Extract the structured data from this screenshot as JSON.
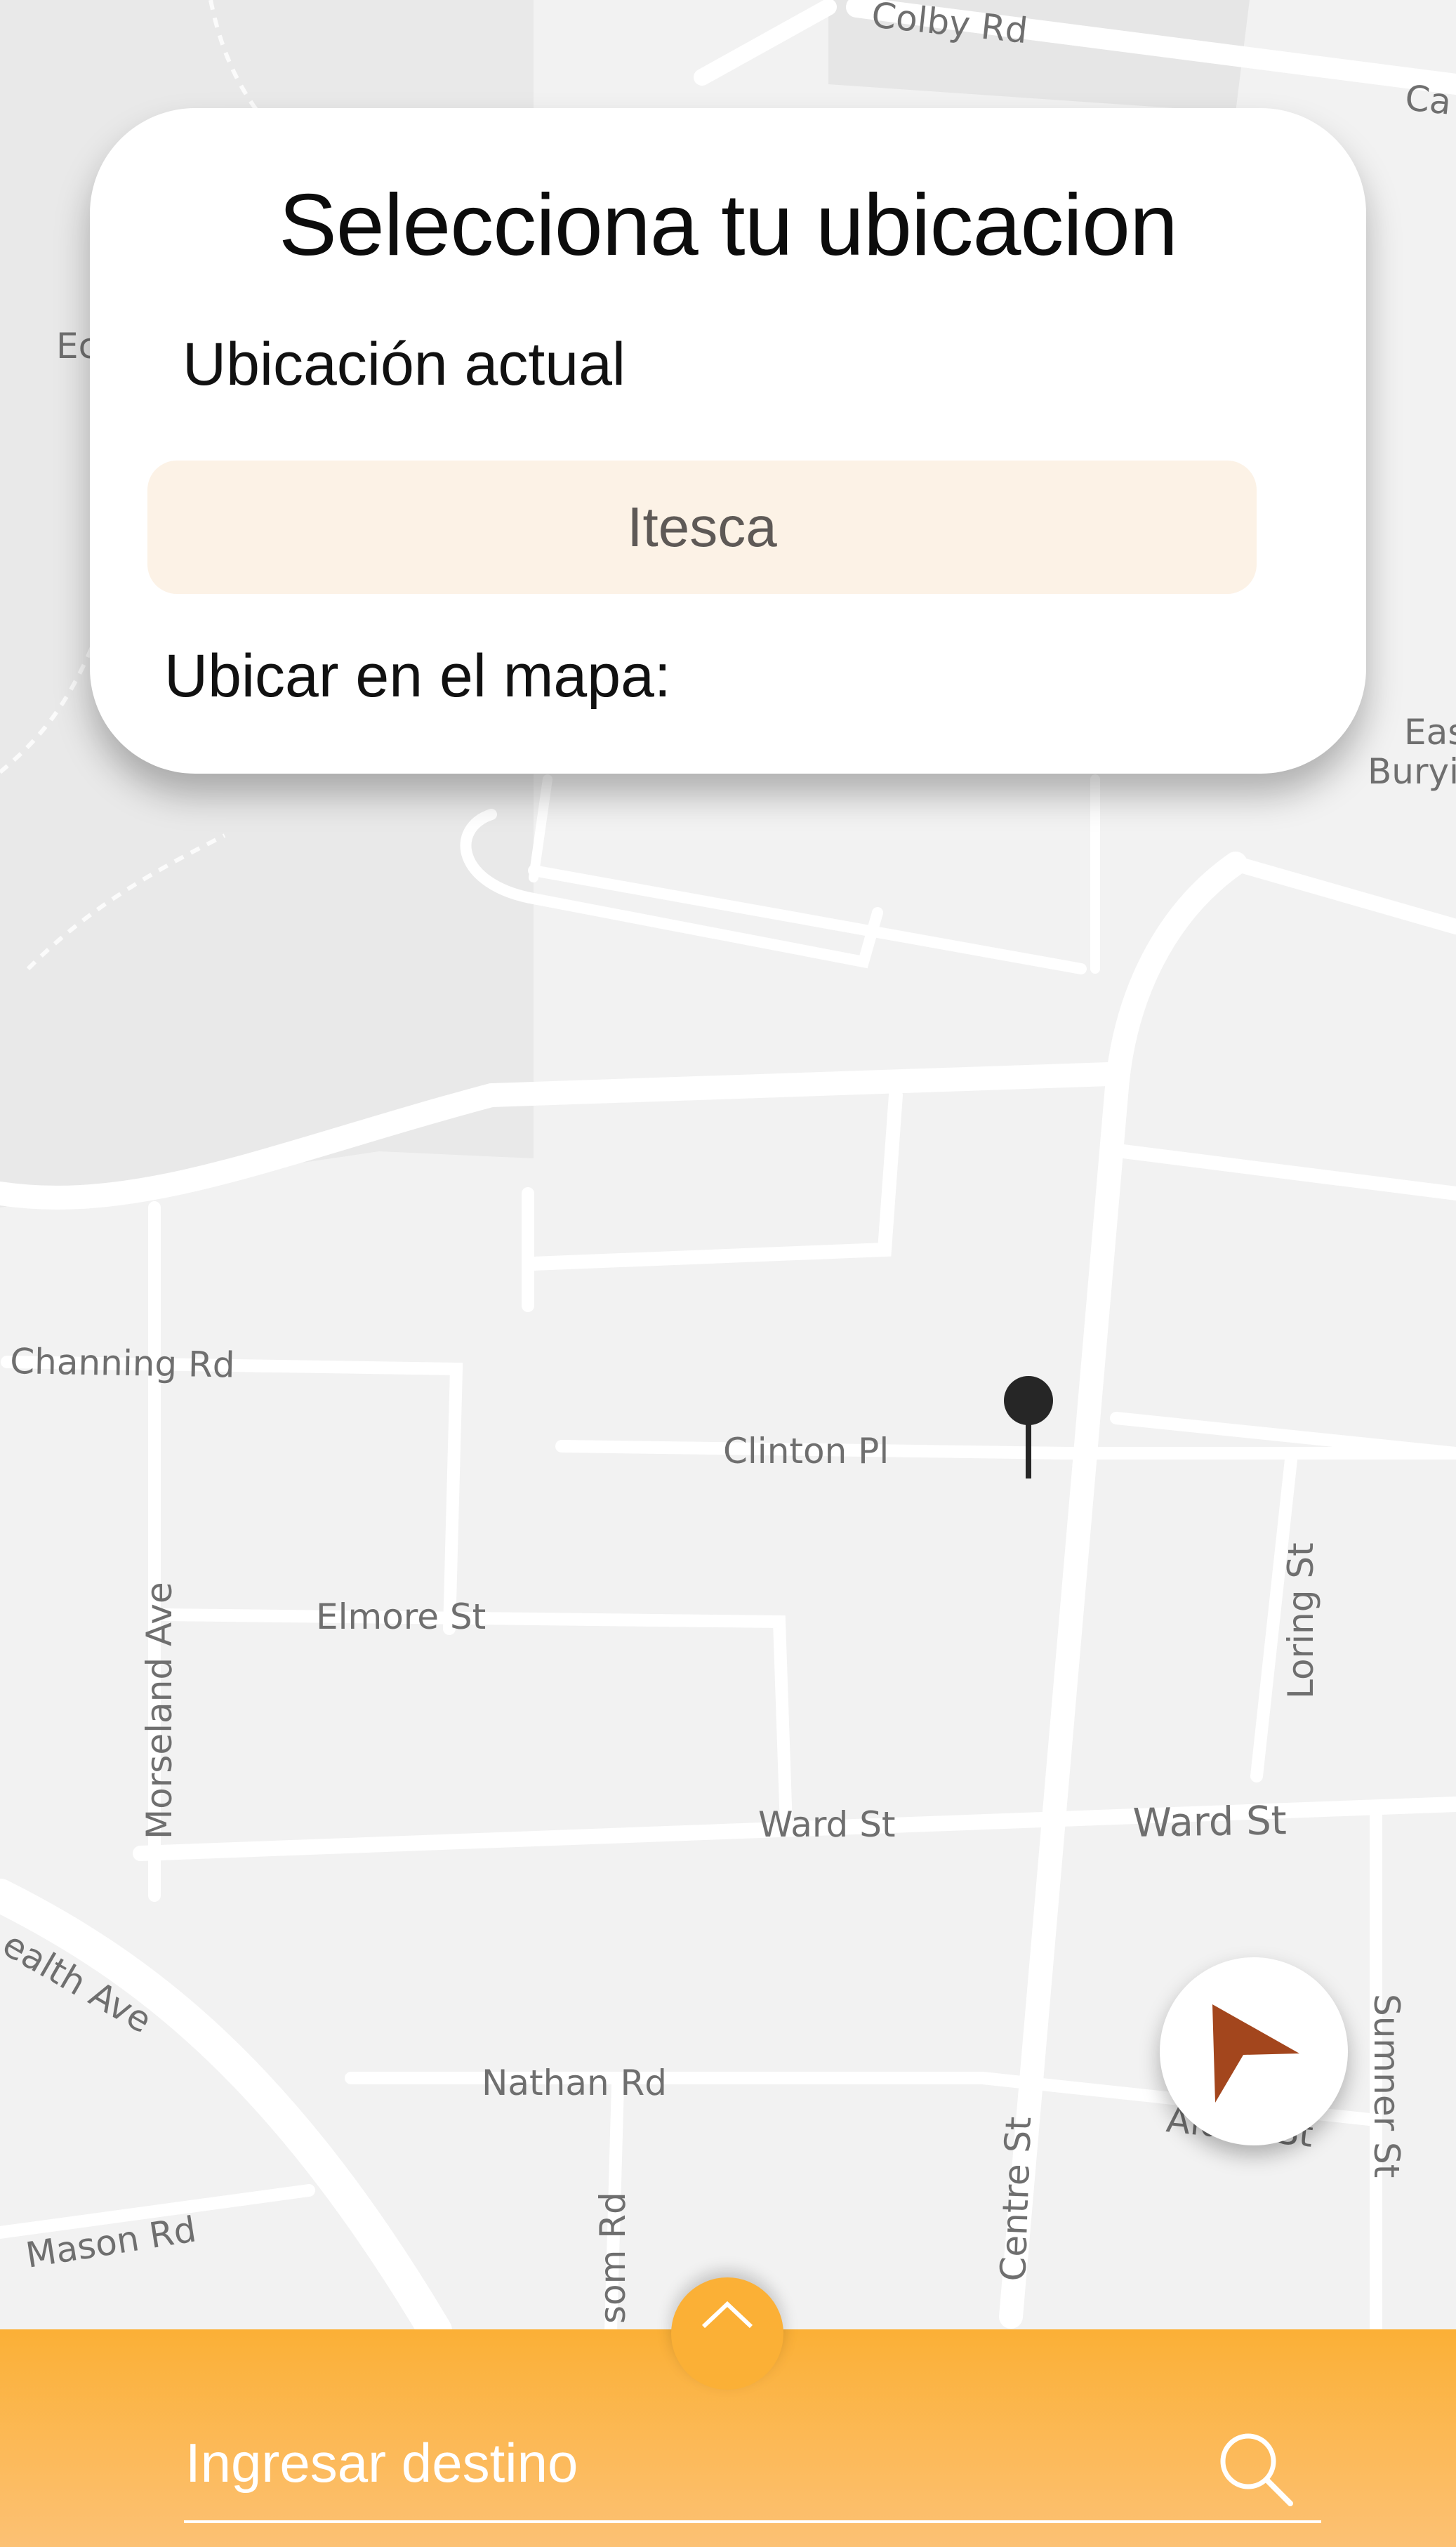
{
  "card": {
    "title": "Selecciona tu ubicacion",
    "current_location_label": "Ubicación actual",
    "current_location_value": "Itesca",
    "map_locate_label": "Ubicar en el mapa:"
  },
  "map": {
    "streets": {
      "colby": "Colby Rd",
      "ca": "Ca",
      "ec": "Ec",
      "east_burying": "Eas",
      "east_burying_2": "Buryi",
      "channing": "Channing Rd",
      "clinton": "Clinton Pl",
      "elmore": "Elmore St",
      "morseland": "Morseland Ave",
      "loring": "Loring St",
      "ward_1": "Ward St",
      "ward_2": "Ward St",
      "commonwealth": "ealth Ave",
      "nathan": "Nathan Rd",
      "alden": "Alden St",
      "sumner": "Sumner St",
      "centre": "Centre St",
      "mason": "Mason Rd",
      "som": "som Rd"
    }
  },
  "destination": {
    "placeholder": "Ingresar destino"
  },
  "colors": {
    "accent_orange": "#fbb036",
    "pill_bg": "#fcf2e6",
    "nav_arrow": "#a3461d"
  },
  "icons": {
    "pin": "map-pin-icon",
    "navigate": "navigation-arrow-icon",
    "chevron": "chevron-up-icon",
    "search": "search-icon"
  }
}
